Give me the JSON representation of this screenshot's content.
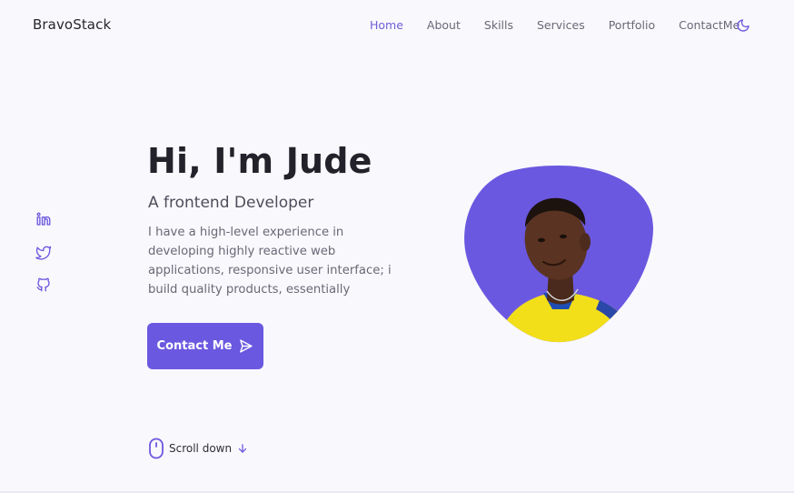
{
  "brand": "BravoStack",
  "nav": {
    "items": [
      {
        "label": "Home",
        "active": true
      },
      {
        "label": "About",
        "active": false
      },
      {
        "label": "Skills",
        "active": false
      },
      {
        "label": "Services",
        "active": false
      },
      {
        "label": "Portfolio",
        "active": false
      },
      {
        "label": "ContactMe",
        "active": false
      }
    ],
    "theme_toggle_icon": "moon-icon"
  },
  "social": {
    "icons": [
      "linkedin-icon",
      "twitter-icon",
      "github-icon"
    ]
  },
  "hero": {
    "title": "Hi, I'm Jude",
    "subtitle": "A frontend Developer",
    "description": "I have a high-level experience in developing highly reactive web applications, responsive user interface; i build quality products, essentially",
    "cta_label": "Contact Me",
    "cta_icon": "send-icon"
  },
  "scroll": {
    "label": "Scroll down",
    "icon": "mouse-icon",
    "arrow_icon": "arrow-down-icon"
  },
  "colors": {
    "accent": "#6b58e0",
    "background": "#f9f8fc",
    "text_dark": "#23222a",
    "text_muted": "#6a6876"
  }
}
